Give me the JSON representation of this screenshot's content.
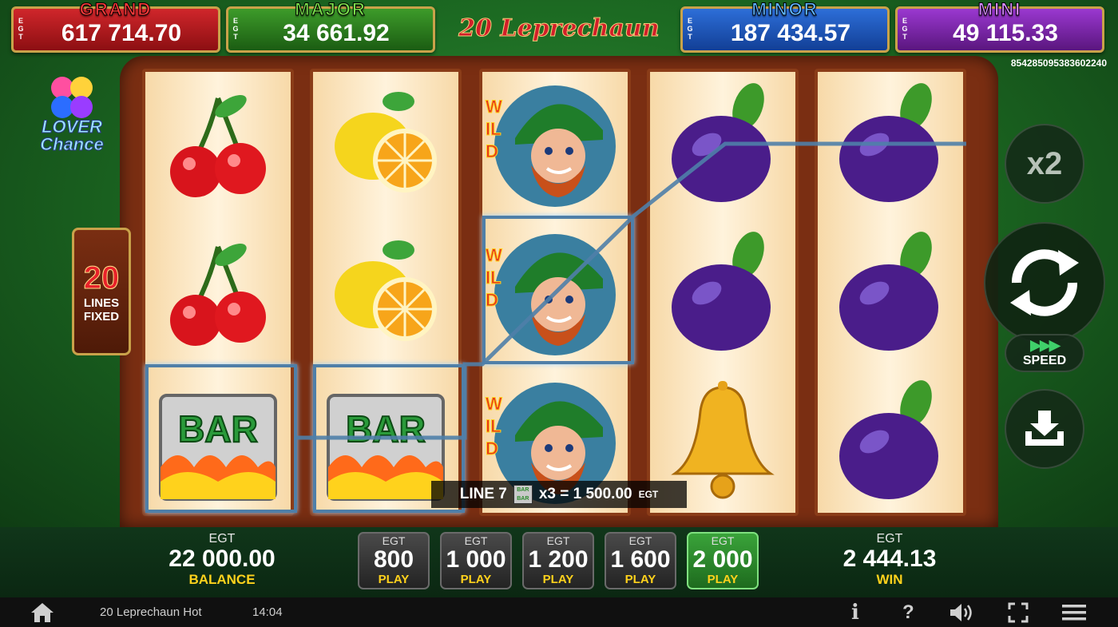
{
  "jackpots": {
    "grand": {
      "title": "GRAND",
      "value": "617 714.70",
      "egt": "EGT"
    },
    "major": {
      "title": "MAJOR",
      "value": "34 661.92",
      "egt": "EGT"
    },
    "minor": {
      "title": "MINOR",
      "value": "187 434.57",
      "egt": "EGT"
    },
    "mini": {
      "title": "MINI",
      "value": "49 115.33",
      "egt": "EGT"
    }
  },
  "logo": {
    "text": "20 Leprechaun Hot"
  },
  "ticket_id": "854285095383602240",
  "lover_chance": {
    "text": "LOVER Chance"
  },
  "lines": {
    "number": "20",
    "label1": "LINES",
    "label2": "FIXED"
  },
  "reels": [
    [
      "cherry",
      "cherry",
      "bar"
    ],
    [
      "lemon",
      "lemon",
      "bar"
    ],
    [
      "wild",
      "wild",
      "wild"
    ],
    [
      "plum",
      "plum",
      "bell"
    ],
    [
      "plum",
      "plum",
      "plum"
    ]
  ],
  "symbol_labels": {
    "bar": "BAR",
    "wild": "WILD",
    "mini_bar": "BAR BAR"
  },
  "win_line": {
    "line": "LINE 7",
    "multiplier": "x3 = 1 500.00",
    "currency": "EGT"
  },
  "controls": {
    "x2": "x2",
    "speed": "SPEED",
    "speed_arrows": "▶▶▶"
  },
  "balance": {
    "currency": "EGT",
    "value": "22 000.00",
    "label": "BALANCE"
  },
  "bets": [
    {
      "currency": "EGT",
      "value": "800",
      "label": "PLAY",
      "active": false
    },
    {
      "currency": "EGT",
      "value": "1 000",
      "label": "PLAY",
      "active": false
    },
    {
      "currency": "EGT",
      "value": "1 200",
      "label": "PLAY",
      "active": false
    },
    {
      "currency": "EGT",
      "value": "1 600",
      "label": "PLAY",
      "active": false
    },
    {
      "currency": "EGT",
      "value": "2 000",
      "label": "PLAY",
      "active": true
    }
  ],
  "win": {
    "currency": "EGT",
    "value": "2 444.13",
    "label": "WIN"
  },
  "statusbar": {
    "game_name": "20 Leprechaun Hot",
    "time": "14:04",
    "info": "i",
    "help": "?"
  },
  "colors": {
    "grand": "#d0262b",
    "major": "#3d9b2a",
    "minor": "#2d6ed8",
    "mini": "#9a38d0",
    "label_yellow": "#ffd21c"
  }
}
